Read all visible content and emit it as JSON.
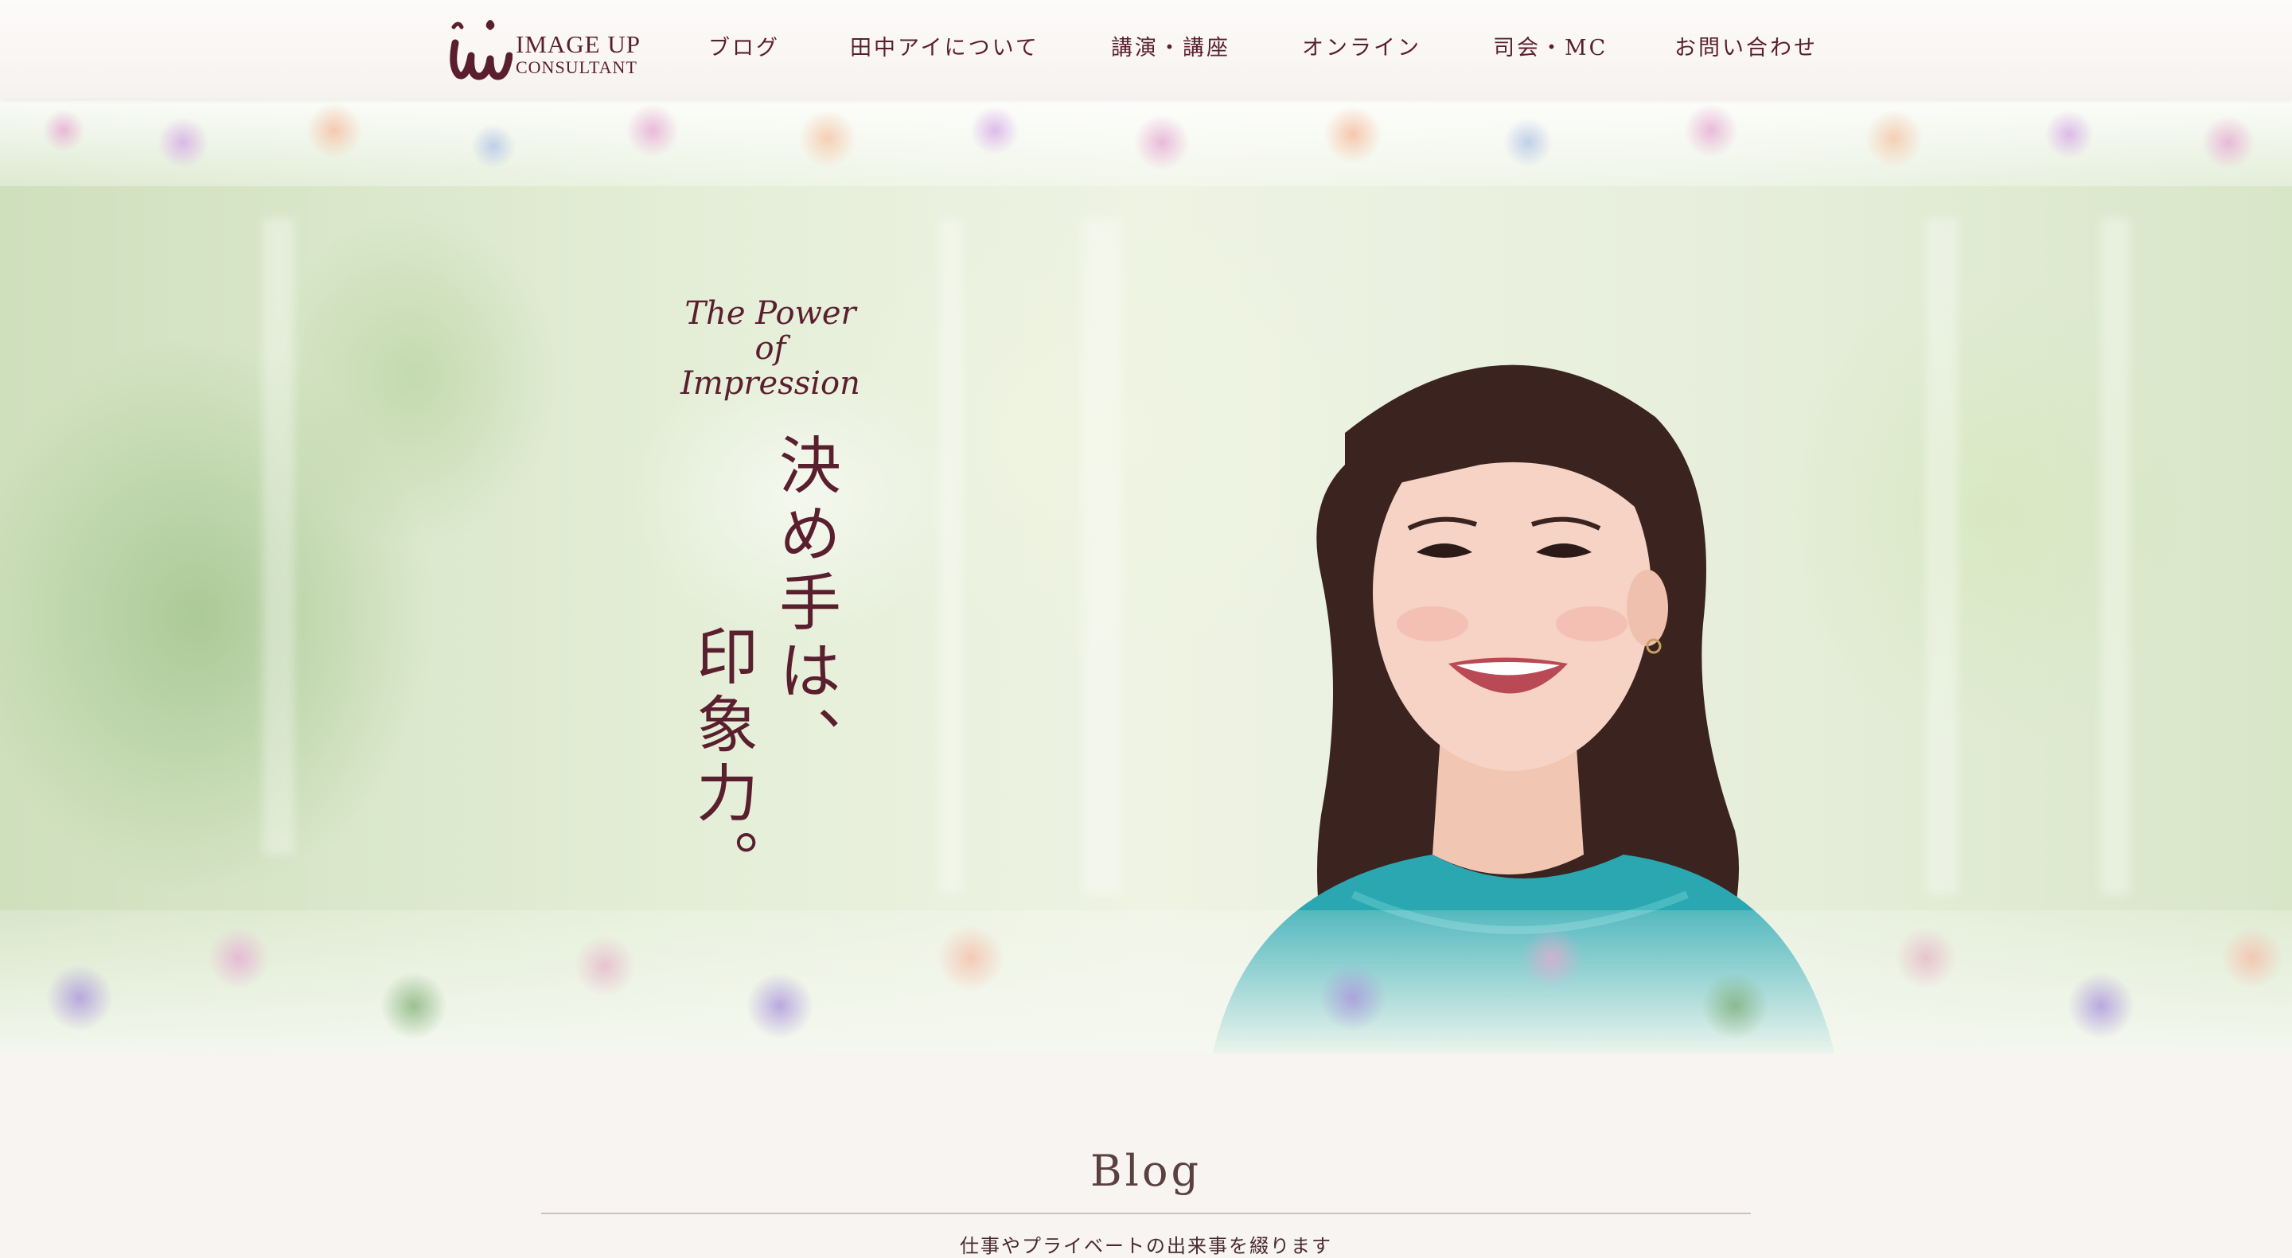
{
  "logo": {
    "line1": "IMAGE UP",
    "line2": "CONSULTANT",
    "mark_icon": "iu-monogram-logo"
  },
  "nav": {
    "items": [
      {
        "label": "ブログ"
      },
      {
        "label": "田中アイについて"
      },
      {
        "label": "講演・講座"
      },
      {
        "label": "オンライン"
      },
      {
        "label": "司会・MC"
      },
      {
        "label": "お問い合わせ"
      }
    ]
  },
  "hero": {
    "tagline_en": [
      "The Power",
      "of",
      "Impression"
    ],
    "catch_line1": "決め手は、",
    "catch_line2": "印象力。"
  },
  "blog": {
    "title": "Blog",
    "subtitle": "仕事やプライベートの出来事を綴ります"
  },
  "colors": {
    "brand": "#5a1f2e",
    "background": "#f7f4f1"
  }
}
